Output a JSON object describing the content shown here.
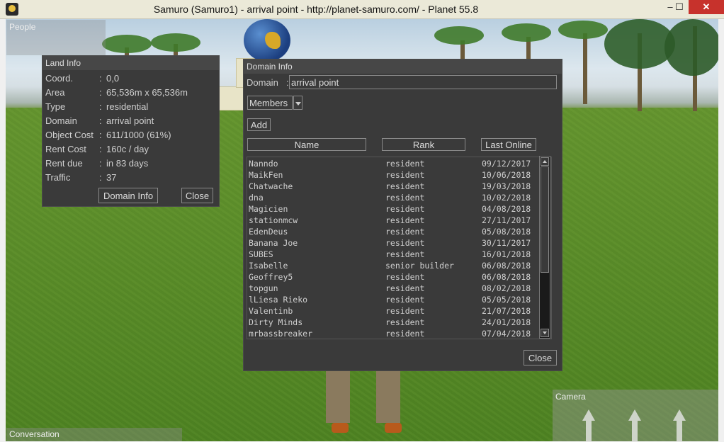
{
  "window": {
    "title": "Samuro (Samuro1) - arrival point - http://planet-samuro.com/ - Planet 55.8",
    "min": "–",
    "max": "☐",
    "close": "✕"
  },
  "overlays": {
    "people": "People",
    "conversation": "Conversation",
    "camera": "Camera"
  },
  "land_info": {
    "title": "Land Info",
    "rows": [
      {
        "key": "Coord.",
        "value": "0,0"
      },
      {
        "key": "Area",
        "value": "65,536m x 65,536m"
      },
      {
        "key": "Type",
        "value": "residential"
      },
      {
        "key": "Domain",
        "value": "arrival point"
      },
      {
        "key": "Object Cost",
        "value": "611/1000 (61%)"
      },
      {
        "key": "Rent Cost",
        "value": "160c / day"
      },
      {
        "key": "Rent due",
        "value": "in 83 days"
      },
      {
        "key": "Traffic",
        "value": "37"
      }
    ],
    "domain_info_button": "Domain Info",
    "close_button": "Close"
  },
  "domain_info": {
    "title": "Domain Info",
    "domain_label": "Domain",
    "domain_value": "arrival point",
    "view_select": "Members",
    "add_button": "Add",
    "columns": [
      "Name",
      "Rank",
      "Last Online"
    ],
    "members": [
      [
        "Nanndo",
        "resident",
        "09/12/2017"
      ],
      [
        "MaikFen",
        "resident",
        "10/06/2018"
      ],
      [
        "Chatwache",
        "resident",
        "19/03/2018"
      ],
      [
        "dna",
        "resident",
        "10/02/2018"
      ],
      [
        "Magicien",
        "resident",
        "04/08/2018"
      ],
      [
        "stationmcw",
        "resident",
        "27/11/2017"
      ],
      [
        "EdenDeus",
        "resident",
        "05/08/2018"
      ],
      [
        "Banana Joe",
        "resident",
        "30/11/2017"
      ],
      [
        "SUBES",
        "resident",
        "16/01/2018"
      ],
      [
        "Isabelle",
        "senior builder",
        "06/08/2018"
      ],
      [
        "Geoffrey5",
        "resident",
        "06/08/2018"
      ],
      [
        "topgun",
        "resident",
        "08/02/2018"
      ],
      [
        "lLiesa Rieko",
        "resident",
        "05/05/2018"
      ],
      [
        "Valentinb",
        "resident",
        "21/07/2018"
      ],
      [
        "Dirty Minds",
        "resident",
        "24/01/2018"
      ],
      [
        "mrbassbreaker",
        "resident",
        "07/04/2018"
      ]
    ],
    "close_button": "Close"
  }
}
